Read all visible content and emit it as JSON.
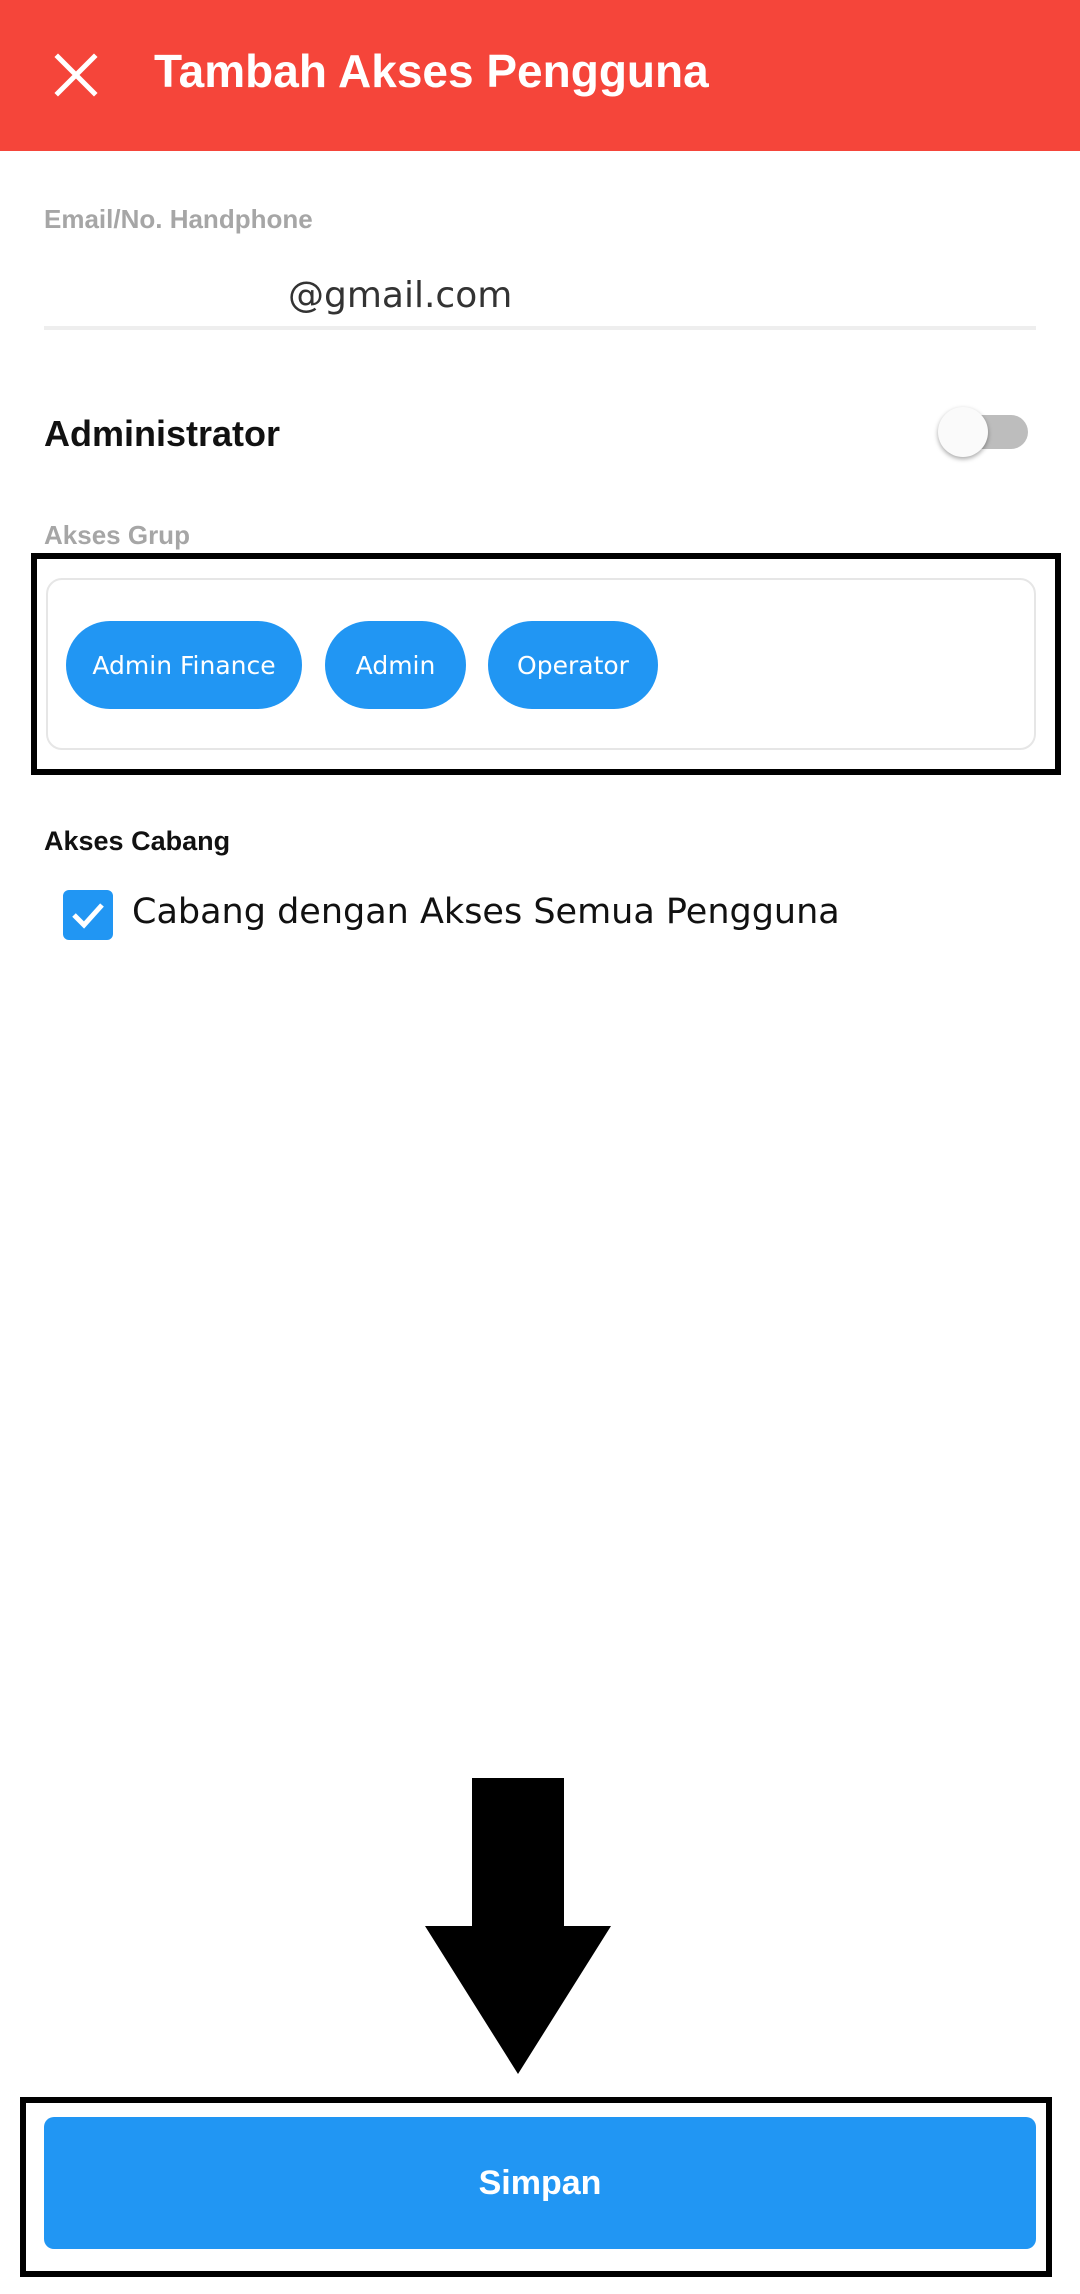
{
  "header": {
    "title": "Tambah Akses Pengguna",
    "background_color": "#f5453a",
    "close_icon": "close-icon"
  },
  "form": {
    "email_label": "Email/No. Handphone",
    "email_value": "@gmail.com",
    "administrator_label": "Administrator",
    "administrator_enabled": false,
    "group_label": "Akses Grup",
    "groups": [
      "Admin Finance",
      "Admin",
      "Operator"
    ],
    "branch_label": "Akses Cabang",
    "branch_checkbox_label": "Cabang dengan Akses Semua Pengguna",
    "branch_checkbox_checked": true
  },
  "footer": {
    "save_label": "Simpan"
  },
  "colors": {
    "accent": "#2196f3",
    "header": "#f5453a",
    "annotation": "#000000"
  },
  "annotations": {
    "arrow_icon": "arrow-down-icon"
  }
}
